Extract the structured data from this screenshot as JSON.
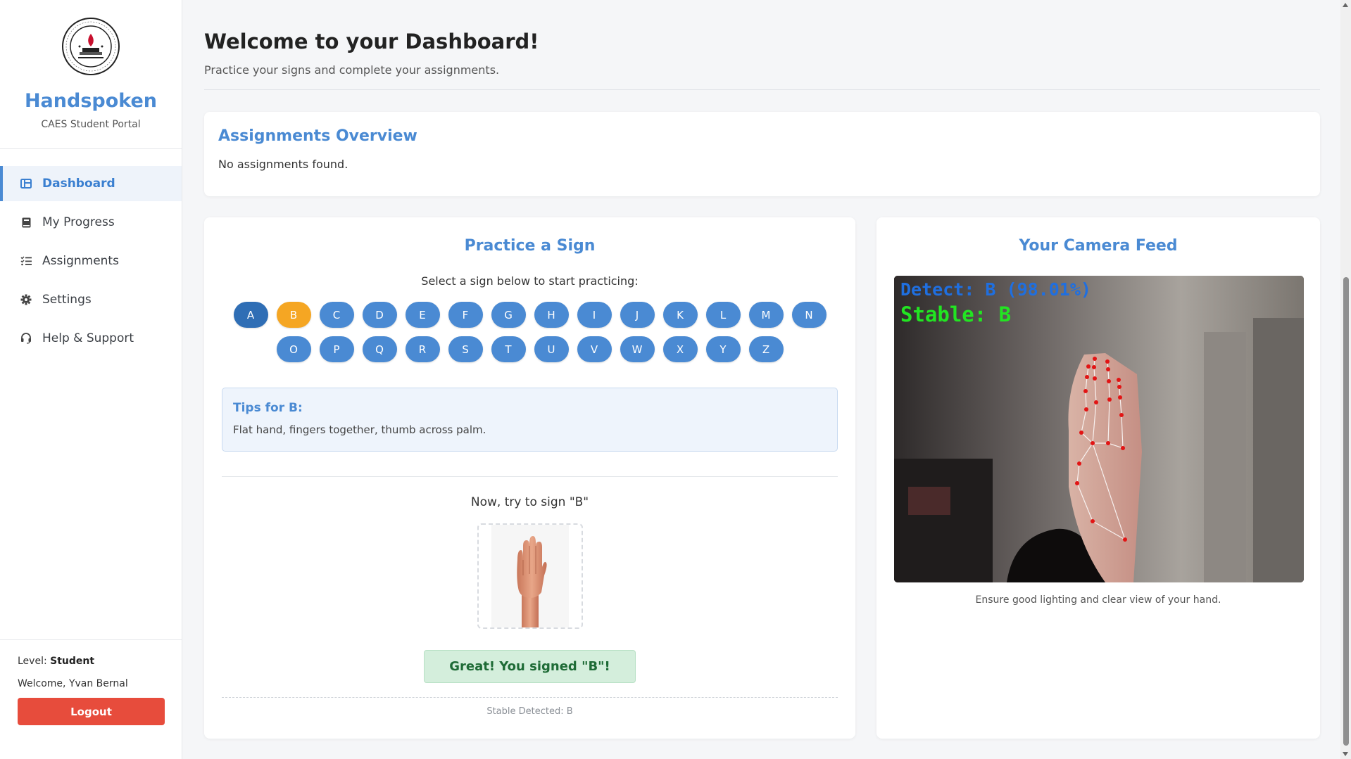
{
  "app": {
    "title": "Handspoken",
    "subtitle": "CAES Student Portal",
    "logo_text": "PAARALANG ELEMENTARYA NG CECILIO APOSTOL CALOOCAN"
  },
  "sidebar": {
    "items": [
      {
        "label": "Dashboard",
        "icon": "dashboard-icon",
        "active": true
      },
      {
        "label": "My Progress",
        "icon": "book-icon",
        "active": false
      },
      {
        "label": "Assignments",
        "icon": "list-check-icon",
        "active": false
      },
      {
        "label": "Settings",
        "icon": "gear-icon",
        "active": false
      },
      {
        "label": "Help & Support",
        "icon": "headset-icon",
        "active": false
      }
    ],
    "level_label": "Level:",
    "level_value": "Student",
    "welcome": "Welcome, Yvan Bernal",
    "logout_label": "Logout"
  },
  "header": {
    "title": "Welcome to your Dashboard!",
    "subtitle": "Practice your signs and complete your assignments."
  },
  "assignments": {
    "title": "Assignments Overview",
    "empty_text": "No assignments found."
  },
  "practice": {
    "title": "Practice a Sign",
    "select_text": "Select a sign below to start practicing:",
    "letters_row1": [
      "A",
      "B",
      "C",
      "D",
      "E",
      "F",
      "G",
      "H",
      "I",
      "J",
      "K",
      "L",
      "M",
      "N"
    ],
    "letters_row2": [
      "O",
      "P",
      "Q",
      "R",
      "S",
      "T",
      "U",
      "V",
      "W",
      "X",
      "Y",
      "Z"
    ],
    "selected": "B",
    "tips_title": "Tips for B:",
    "tips_text": "Flat hand, fingers together, thumb across palm.",
    "try_text": "Now, try to sign \"B\"",
    "success_text": "Great! You signed \"B\"!",
    "stable_text": "Stable Detected: B"
  },
  "camera": {
    "title": "Your Camera Feed",
    "detect_text": "Detect: B (98.01%)",
    "stable_text": "Stable: B",
    "note": "Ensure good lighting and clear view of your hand."
  },
  "colors": {
    "accent": "#4a8ad3",
    "selected_letter": "#f5a623",
    "logout": "#e74c3c",
    "success_bg": "#d4eedc"
  }
}
